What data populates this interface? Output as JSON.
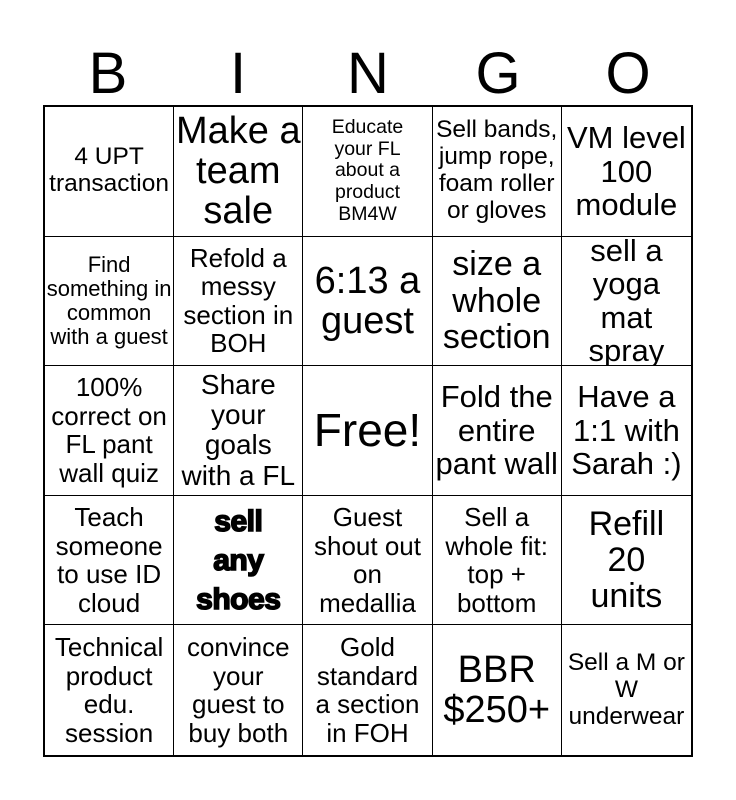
{
  "header": {
    "letters": [
      "B",
      "I",
      "N",
      "G",
      "O"
    ]
  },
  "grid": {
    "rows": 5,
    "columns": 5,
    "border_color": "#000000",
    "background_color": "#ffffff",
    "text_color": "#000000",
    "cells": [
      {
        "text": "4 UPT\ntransaction",
        "size": "s24",
        "style": "normal"
      },
      {
        "text": "Make a\nteam\nsale",
        "size": "s38",
        "style": "normal"
      },
      {
        "text": "Educate\nyour FL\nabout a\nproduct\nBM4W",
        "size": "s19",
        "style": "normal"
      },
      {
        "text": "Sell bands,\njump rope,\nfoam roller\nor gloves",
        "size": "s24",
        "style": "normal"
      },
      {
        "text": "VM level\n100\nmodule",
        "size": "s31",
        "style": "normal"
      },
      {
        "text": "Find\nsomething in\ncommon\nwith a guest",
        "size": "s22",
        "style": "normal"
      },
      {
        "text": "Refold a\nmessy\nsection in\nBOH",
        "size": "s26",
        "style": "normal"
      },
      {
        "text": "6:13 a\nguest",
        "size": "s38",
        "style": "normal"
      },
      {
        "text": "size a\nwhole\nsection",
        "size": "s34",
        "style": "normal"
      },
      {
        "text": "sell a\nyoga mat\nspray",
        "size": "s31",
        "style": "normal"
      },
      {
        "text": "100%\ncorrect on\nFL pant\nwall quiz",
        "size": "s26",
        "style": "normal"
      },
      {
        "text": "Share\nyour goals\nwith a FL",
        "size": "s28",
        "style": "normal"
      },
      {
        "text": "Free!",
        "size": "s46",
        "style": "normal"
      },
      {
        "text": "Fold the\nentire\npant wall",
        "size": "s31",
        "style": "normal"
      },
      {
        "text": "Have a\n1:1 with\nSarah :)",
        "size": "s31",
        "style": "normal"
      },
      {
        "text": "Teach\nsomeone\nto use ID\ncloud",
        "size": "s26",
        "style": "normal"
      },
      {
        "text": "sell\nany\nshoes",
        "size": "s28",
        "style": "black"
      },
      {
        "text": "Guest\nshout out\non\nmedallia",
        "size": "s26",
        "style": "normal"
      },
      {
        "text": "Sell a\nwhole fit:\ntop +\nbottom",
        "size": "s26",
        "style": "normal"
      },
      {
        "text": "Refill\n20\nunits",
        "size": "s34",
        "style": "normal"
      },
      {
        "text": "Technical\nproduct\nedu.\nsession",
        "size": "s26",
        "style": "normal"
      },
      {
        "text": "convince\nyour\nguest to\nbuy both",
        "size": "s26",
        "style": "normal"
      },
      {
        "text": "Gold\nstandard\na section\nin FOH",
        "size": "s26",
        "style": "normal"
      },
      {
        "text": "BBR\n$250+",
        "size": "s38",
        "style": "normal"
      },
      {
        "text": "Sell a M or\nW\nunderwear",
        "size": "s24",
        "style": "normal"
      }
    ]
  }
}
